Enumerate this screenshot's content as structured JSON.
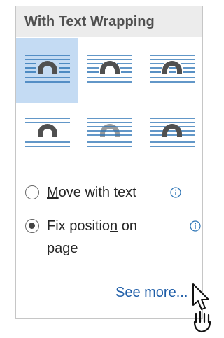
{
  "panel": {
    "header": "With Text Wrapping",
    "options": [
      {
        "name": "square",
        "selected": true
      },
      {
        "name": "tight",
        "selected": false
      },
      {
        "name": "through",
        "selected": false
      },
      {
        "name": "top-and-bottom",
        "selected": false
      },
      {
        "name": "behind-text",
        "selected": false
      },
      {
        "name": "in-front-of-text",
        "selected": false
      }
    ],
    "radios": [
      {
        "pre": "",
        "ul": "M",
        "post": "ove with text",
        "checked": false
      },
      {
        "pre": "Fix positio",
        "ul": "n",
        "post": " on",
        "line2": "page",
        "checked": true
      }
    ],
    "see_more": "See more..."
  },
  "colors": {
    "accent": "#2e75b6",
    "selected_bg": "#c4dbf3",
    "arc_default": "#505050",
    "arc_light": "#9a9a9a",
    "link": "#1f5ea8"
  }
}
